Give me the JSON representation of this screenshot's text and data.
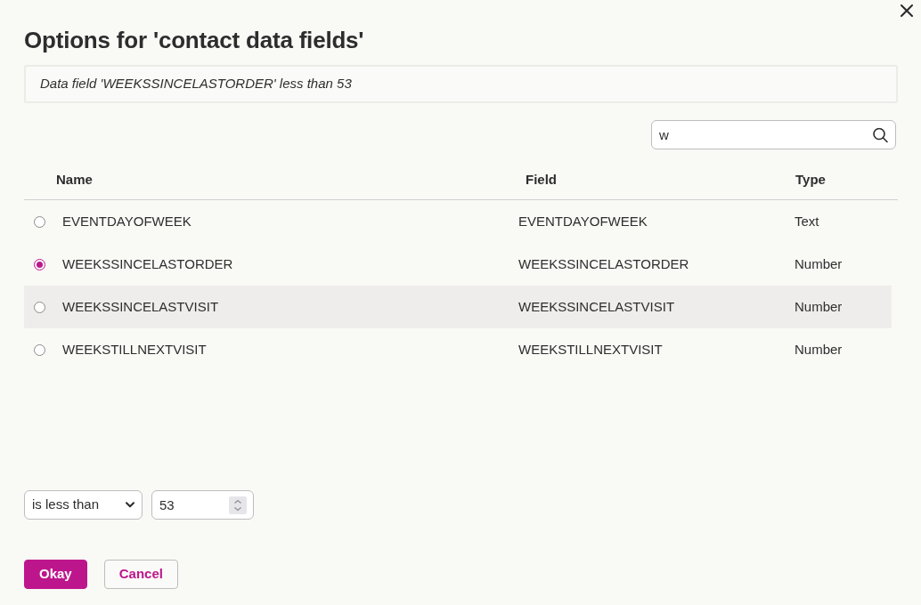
{
  "dialog": {
    "title": "Options for 'contact data fields'",
    "summary": "Data field 'WEEKSSINCELASTORDER' less than 53"
  },
  "search": {
    "value": "w"
  },
  "table": {
    "columns": [
      "Name",
      "Field",
      "Type"
    ],
    "rows": [
      {
        "name": "EVENTDAYOFWEEK",
        "field": "EVENTDAYOFWEEK",
        "type": "Text",
        "selected": false,
        "hovered": false
      },
      {
        "name": "WEEKSSINCELASTORDER",
        "field": "WEEKSSINCELASTORDER",
        "type": "Number",
        "selected": true,
        "hovered": false
      },
      {
        "name": "WEEKSSINCELASTVISIT",
        "field": "WEEKSSINCELASTVISIT",
        "type": "Number",
        "selected": false,
        "hovered": true
      },
      {
        "name": "WEEKSTILLNEXTVISIT",
        "field": "WEEKSTILLNEXTVISIT",
        "type": "Number",
        "selected": false,
        "hovered": false
      }
    ]
  },
  "condition": {
    "operator": "is less than",
    "value": "53"
  },
  "buttons": [
    {
      "label": "Okay",
      "kind": "primary"
    },
    {
      "label": "Cancel",
      "kind": "secondary"
    }
  ]
}
